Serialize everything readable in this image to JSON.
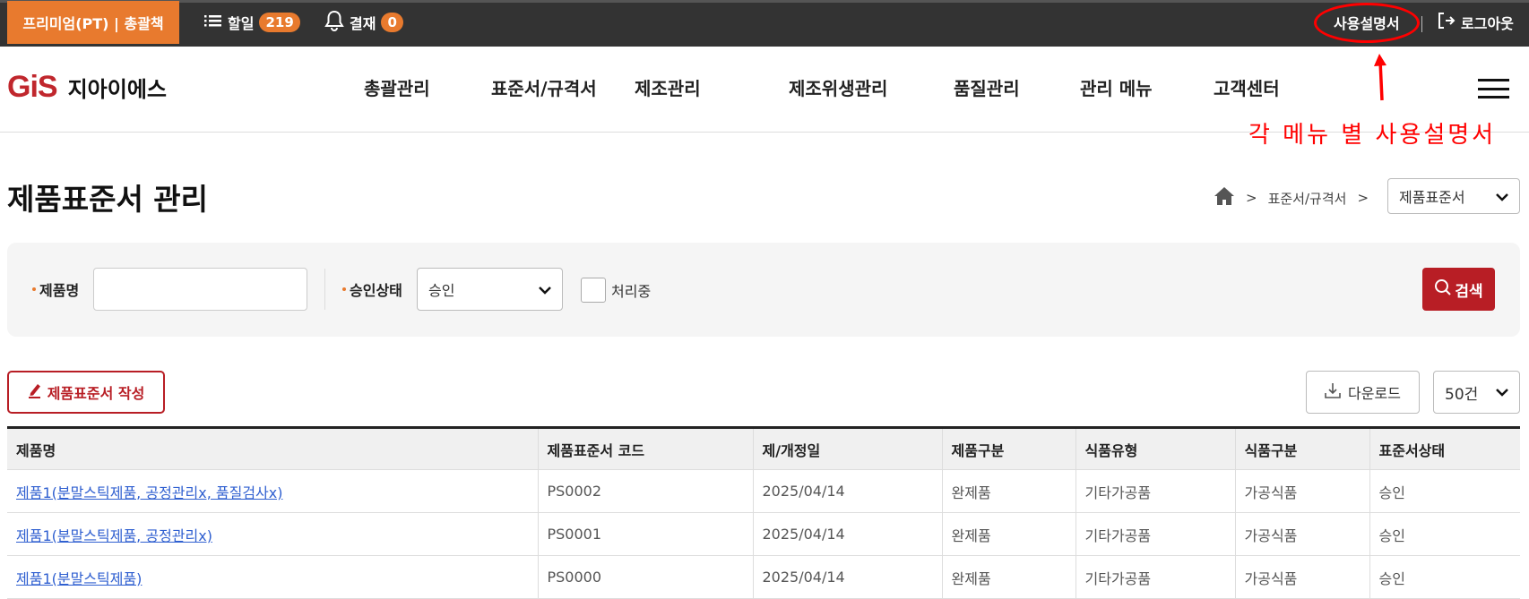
{
  "topbar": {
    "plan": "프리미엄(PT) | 총괄책",
    "todo_label": "할일",
    "todo_count": "219",
    "approval_label": "결재",
    "approval_count": "0",
    "help": "사용설명서",
    "logout": "로그아웃"
  },
  "logo": {
    "mark": "GiS",
    "text": "지아이에스"
  },
  "nav": [
    "총괄관리",
    "표준서/규격서",
    "제조관리",
    "제조위생관리",
    "품질관리",
    "관리 메뉴",
    "고객센터"
  ],
  "annotation": "각 메뉴 별 사용설명서",
  "page": {
    "title": "제품표준서 관리",
    "breadcrumb": [
      "표준서/규격서"
    ],
    "breadcrumb_select": "제품표준서"
  },
  "filter": {
    "name_label": "제품명",
    "name_value": "",
    "status_label": "승인상태",
    "status_value": "승인",
    "processing_label": "처리중",
    "processing_checked": false,
    "search": "검색"
  },
  "actions": {
    "write": "제품표준서 작성",
    "download": "다운로드",
    "page_size": "50건"
  },
  "table": {
    "headers": [
      "제품명",
      "제품표준서 코드",
      "제/개정일",
      "제품구분",
      "식품유형",
      "식품구분",
      "표준서상태"
    ],
    "rows": [
      [
        "제품1(분말스틱제품, 공정관리x, 품질검사x)",
        "PS0002",
        "2025/04/14",
        "완제품",
        "기타가공품",
        "가공식품",
        "승인"
      ],
      [
        "제품1(분말스틱제품, 공정관리x)",
        "PS0001",
        "2025/04/14",
        "완제품",
        "기타가공품",
        "가공식품",
        "승인"
      ],
      [
        "제품1(분말스틱제품)",
        "PS0000",
        "2025/04/14",
        "완제품",
        "기타가공품",
        "가공식품",
        "승인"
      ]
    ]
  },
  "colors": {
    "accent": "#e87a2e",
    "brand_red": "#b81e25",
    "topbar": "#333333",
    "annotation": "#ff0000"
  }
}
